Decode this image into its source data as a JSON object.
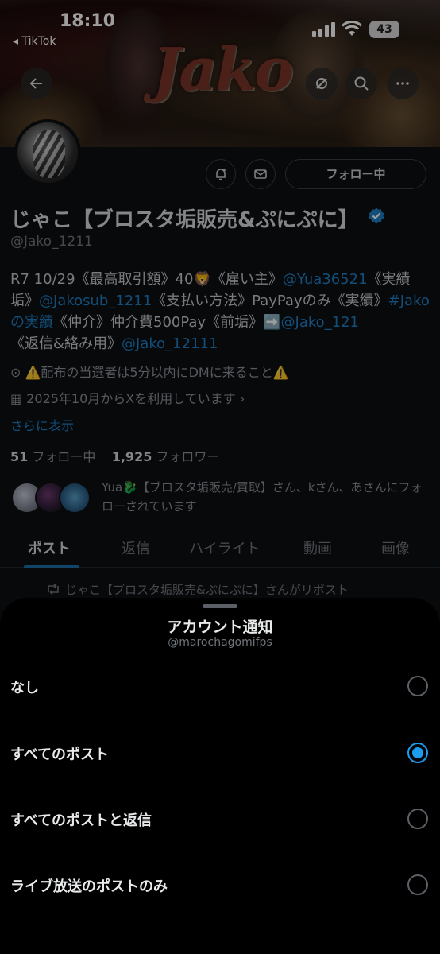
{
  "status_bar": {
    "time": "18:10",
    "back_app": "◂ TikTok",
    "battery": "43"
  },
  "banner": {
    "title": "Jako"
  },
  "profile": {
    "follow_button": "フォロー中",
    "display_name": "じゃこ【ブロスタ垢販売&ぷにぷに】",
    "handle": "@Jako_1211",
    "bio": {
      "p1": "R7 10/29《最高取引額》40",
      "emoji_lion": "🦁",
      "p2": "《雇い主》",
      "m1": "@Yua36521",
      "p3": "《実績垢》",
      "m2": "@Jakosub_1211",
      "p4": "《支払い方法》PayPayのみ《実績》",
      "m3": "#Jakoの実績",
      "p5": "《仲介》仲介費500Pay《前垢》",
      "emoji_arrow": "➡️",
      "m4": "@Jako_121",
      "p6": "《返信&絡み用》",
      "m5": "@Jako_12111"
    },
    "location": "⚠️配布の当選者は5分以内にDMに来ること⚠️",
    "joined": "2025年10月からXを利用しています ›",
    "show_more": "さらに表示",
    "following_count": "51",
    "following_label": "フォロー中",
    "followers_count": "1,925",
    "followers_label": "フォロワー",
    "followed_by": "Yua🐉【ブロスタ垢販売/買取】さん、kさん、あさんにフォローされています"
  },
  "tabs": [
    "ポスト",
    "返信",
    "ハイライト",
    "動画",
    "画像"
  ],
  "repost_line": "じゃこ【ブロスタ垢販売&ぷにぷに】さんがリポスト",
  "sheet": {
    "title": "アカウント通知",
    "subtitle": "@marochagomifps",
    "options": [
      {
        "label": "なし",
        "selected": false
      },
      {
        "label": "すべてのポスト",
        "selected": true
      },
      {
        "label": "すべてのポストと返信",
        "selected": false
      },
      {
        "label": "ライブ放送のポストのみ",
        "selected": false
      }
    ]
  },
  "colors": {
    "accent": "#1d9bf0",
    "link": "#1d7fc4",
    "background": "#000000"
  }
}
